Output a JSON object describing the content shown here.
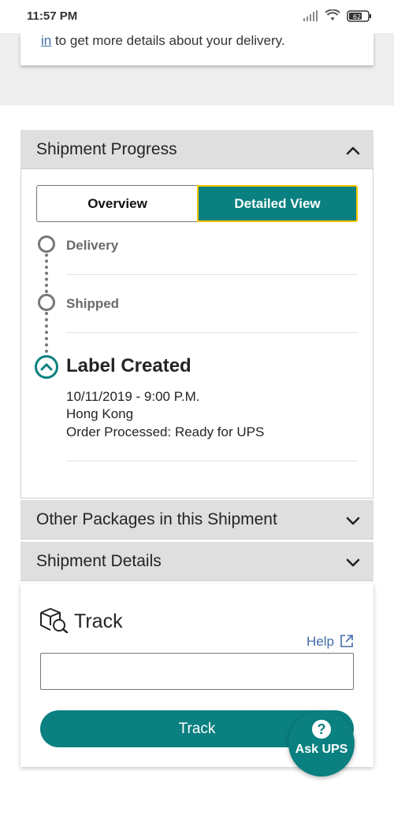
{
  "status_bar": {
    "time": "11:57 PM",
    "battery": "62"
  },
  "top_card": {
    "link_text": "in",
    "text": " to get more details about your delivery."
  },
  "shipment_progress": {
    "header": "Shipment Progress",
    "toggle": {
      "overview": "Overview",
      "detailed": "Detailed View"
    },
    "steps": [
      {
        "label": "Delivery"
      },
      {
        "label": "Shipped"
      }
    ],
    "active": {
      "title": "Label Created",
      "datetime": "10/11/2019 - 9:00 P.M.",
      "location": "Hong Kong",
      "status": "Order Processed: Ready for UPS"
    }
  },
  "other_packages": {
    "header": "Other Packages in this Shipment"
  },
  "shipment_details": {
    "header": "Shipment Details"
  },
  "track": {
    "title": "Track",
    "help": "Help",
    "input_value": "",
    "button": "Track"
  },
  "ask_ups": {
    "icon": "?",
    "label": "Ask UPS"
  },
  "colors": {
    "teal": "#0a8080",
    "link": "#426da9",
    "focus": "#ffc400"
  }
}
